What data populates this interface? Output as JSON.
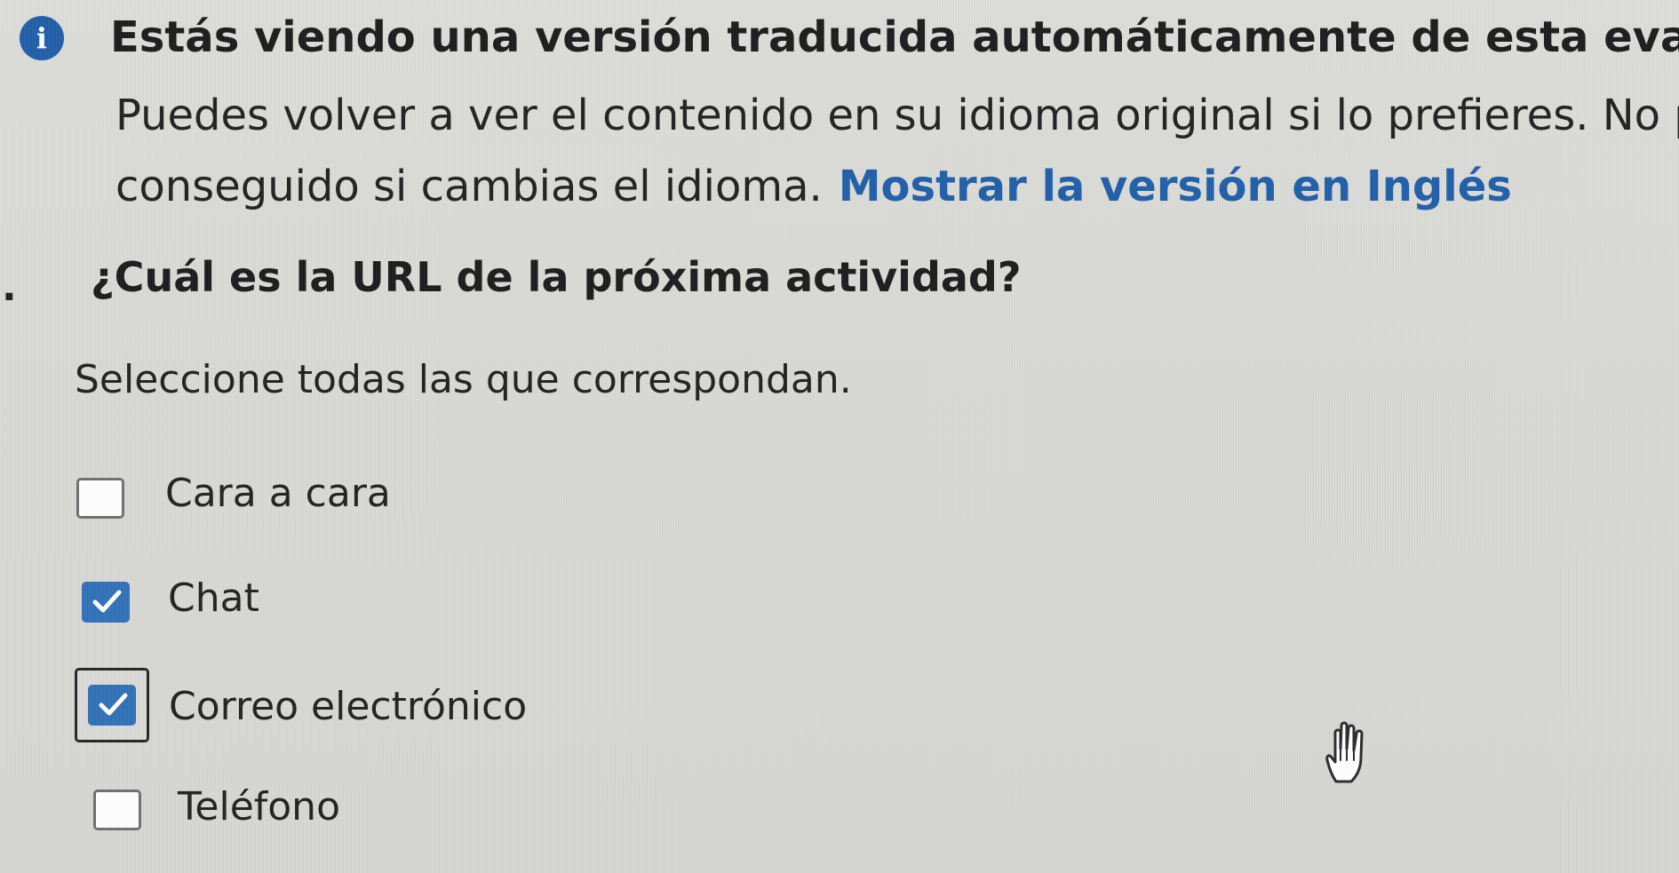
{
  "notice": {
    "icon": "info-icon",
    "title": "Estás viendo una versión traducida automáticamente de esta evaluación",
    "body_line_1": "Puedes volver a ver el contenido en su idioma original si lo prefieres. No perd",
    "body_line_2": "conseguido si cambias el idioma.",
    "link_text": "Mostrar la versión en Inglés",
    "accent_color": "#1f5ea8"
  },
  "question": {
    "bullet": ".",
    "text": "¿Cuál es la URL de la próxima actividad?",
    "instruction": "Seleccione todas las que correspondan."
  },
  "options": [
    {
      "label": "Cara a cara",
      "checked": false
    },
    {
      "label": "Chat",
      "checked": true
    },
    {
      "label": "Correo electrónico",
      "checked": true
    },
    {
      "label": "Teléfono",
      "checked": false
    }
  ],
  "cursor": {
    "icon": "hand-pointer-icon"
  }
}
